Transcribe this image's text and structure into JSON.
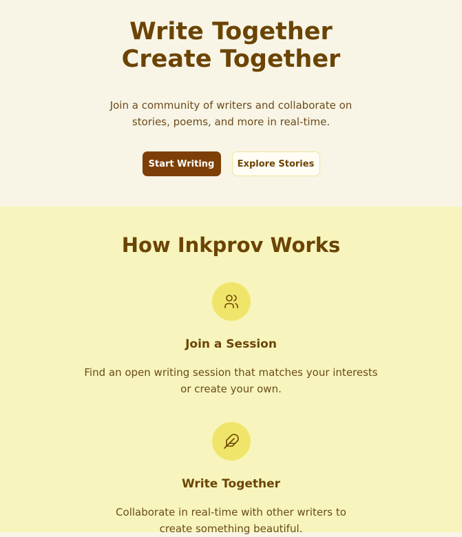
{
  "hero": {
    "title_line1": "Write Together",
    "title_line2": "Create Together",
    "subtitle": "Join a community of writers and collaborate on stories, poems, and more in real-time.",
    "primary_button": "Start Writing",
    "secondary_button": "Explore Stories"
  },
  "how": {
    "title": "How Inkprov Works",
    "steps": [
      {
        "icon": "users-icon",
        "title": "Join a Session",
        "description": "Find an open writing session that matches your interests or create your own."
      },
      {
        "icon": "feather-icon",
        "title": "Write Together",
        "description": "Collaborate in real-time with other writers to create something beautiful."
      }
    ]
  },
  "colors": {
    "brand_brown": "#6b4404",
    "button_brown": "#7d3f05",
    "hero_bg": "#f8f5e6",
    "section_bg": "#f7f5bd",
    "icon_circle": "#f0e56b"
  }
}
